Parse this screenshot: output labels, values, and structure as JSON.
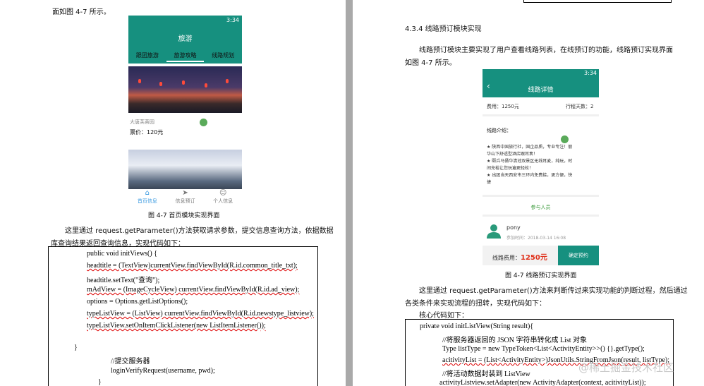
{
  "left_page": {
    "intro_text": "面如图 4-7 所示。",
    "phone": {
      "time": "3:34",
      "title": "旅游",
      "tabs": [
        "跟团旅游",
        "旅游攻略",
        "线路规划"
      ],
      "place": "大唐芙蓉园",
      "price": "票价：120元",
      "nav": [
        "首页信息",
        "信息预订",
        "个人信息"
      ]
    },
    "caption": "图 4-7 首页模块实现界面",
    "para_line1": "这里通过 request.getParameter()方法获取请求参数，提交信息查询方法，依据数据",
    "para_line2": "库查询结果返回查询信息，实现代码如下：",
    "code": [
      "public void initViews() {",
      "headtitle = (TextView)currentView.findViewById(R.id.common_title_txt);",
      "headtitle.setText(\"查询\");",
      "mAdView = (ImageCycleView) currentView.findViewById(R.id.ad_view);",
      "options = Options.getListOptions();",
      "typeListView = (ListView) currentView.findViewById(R.id.newstype_listview);",
      "typeListView.setOnItemClickListener(new ListItemListener());",
      "}",
      "//提交服务器",
      "loginVerifyRequest(username, pwd);",
      "}"
    ]
  },
  "right_page": {
    "heading": "4.3.4 线路预订模块实现",
    "para1_line1": "线路预订模块主要实现了用户查看线路列表，在线预订的功能，线路预订实现界面",
    "para1_line2": "如图 4-7 所示。",
    "phone": {
      "time": "3:34",
      "title": "线路详情",
      "fee": "费用：1250元",
      "days": "行程天数：2",
      "intro_label": "线路介绍：",
      "intro_lines": [
        "★ 陕西中国旅行社，国企品质，专业专注！丽",
        "华山下舒适型酒店跟耳奏！",
        "★ 颐兵马俑华清池双景区无线耳麦，纯玩，时",
        "间充裕让您玩遍更轻松！",
        "★ 出团当天西安市三环内免费接，更方便，快",
        "捷"
      ],
      "participants_label": "参与人员",
      "user_name": "pony",
      "join_time": "参加时间：2018-03-14 16:08",
      "bottom_label": "线路费用：",
      "bottom_amount": "1250元",
      "book_button": "确定预约"
    },
    "caption": "图 4-7 线路预订实现界面",
    "para2_line1": "这里通过 request.getParameter()方法来判断传过来实现功能的判断过程，然后通过",
    "para2_line2": "各类条件来实现流程的扭转，实现代码如下：",
    "core_label": "核心代码如下：",
    "code": [
      "private void initListView(String result){",
      "//将服务器返回的 JSON 字符串转化成 List 对象",
      "Type listType = new TypeToken<List<ActivityEntity>>() {}.getType();",
      "acitivityList = (List<ActivityEntity>)JsonUtils.StringFromJson(result, listType);",
      "//将活动数据封装到 ListView",
      "activityListview.setAdapter(new ActivityAdapter(context, acitivityList));"
    ]
  },
  "watermark": "@稀土掘金技术社区"
}
